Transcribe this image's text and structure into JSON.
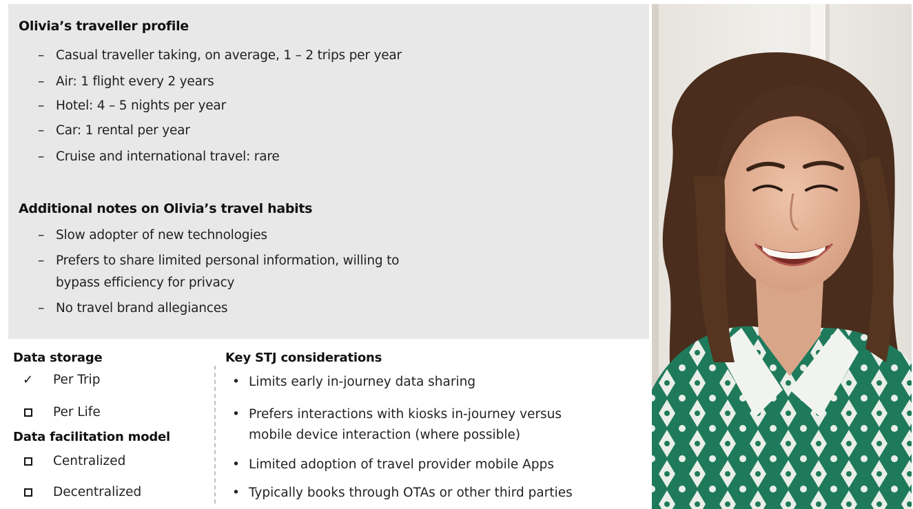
{
  "profile": {
    "title": "Olivia’s traveller profile",
    "items": [
      "Casual traveller taking, on average, 1 – 2 trips per year",
      "Air: 1 flight every 2 years",
      "Hotel: 4 – 5 nights per year",
      "Car: 1 rental per year",
      "Cruise and international travel: rare"
    ]
  },
  "notes": {
    "title": "Additional notes on Olivia’s travel habits",
    "items": [
      [
        "Slow adopter of new technologies"
      ],
      [
        "Prefers to share limited personal information, willing to",
        "bypass efficiency for privacy"
      ],
      [
        "No travel brand allegiances"
      ]
    ]
  },
  "dash_char": "–",
  "check_char": "✓",
  "bullet_char": "•",
  "data_storage": {
    "title": "Data storage",
    "options": [
      {
        "label": "Per Trip",
        "checked": true
      },
      {
        "label": "Per Life",
        "checked": false
      }
    ]
  },
  "data_facilitation": {
    "title": "Data facilitation model",
    "options": [
      {
        "label": "Centralized",
        "checked": false
      },
      {
        "label": "Decentralized",
        "checked": false
      }
    ]
  },
  "stj": {
    "title": "Key STJ considerations",
    "items": [
      [
        "Limits early in-journey data sharing"
      ],
      [
        "Prefers interactions with kiosks in-journey versus",
        "mobile device interaction (where possible)"
      ],
      [
        "Limited adoption of travel provider mobile Apps"
      ],
      [
        "Typically books through OTAs or other third parties"
      ]
    ]
  },
  "colors": {
    "profile_bg": "#e8e8e8",
    "shirt_green": "#1f7a5c",
    "hair": "#4a2d1c",
    "skin": "#e4b49a",
    "wall": "#ece9e4"
  },
  "photo": {
    "icon": "woman-portrait-photo"
  }
}
